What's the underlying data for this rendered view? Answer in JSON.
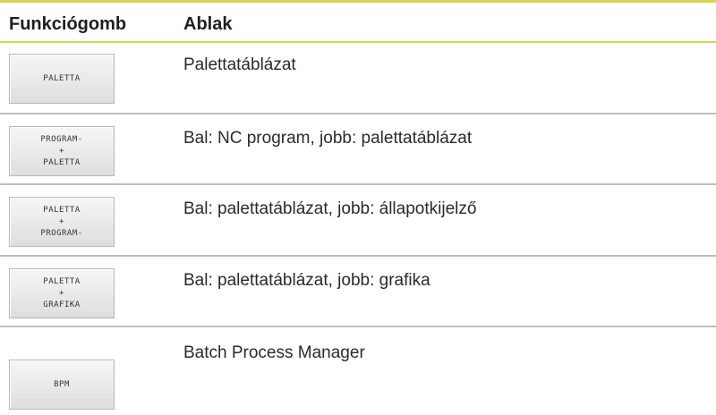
{
  "header": {
    "col1": "Funkciógomb",
    "col2": "Ablak"
  },
  "rows": [
    {
      "softkey_lines": [
        "PALETTA"
      ],
      "description": "Palettatáblázat"
    },
    {
      "softkey_lines": [
        "PROGRAM-",
        "+",
        "PALETTA"
      ],
      "description": "Bal: NC program, jobb: palettatáblázat"
    },
    {
      "softkey_lines": [
        "PALETTA",
        "+",
        "PROGRAM-"
      ],
      "description": "Bal: palettatáblázat, jobb: állapotkijelző"
    },
    {
      "softkey_lines": [
        "PALETTA",
        "+",
        "GRAFIKA"
      ],
      "description": "Bal: palettatáblázat, jobb: grafika"
    },
    {
      "softkey_lines": [
        "BPM"
      ],
      "description": "Batch Process Manager"
    }
  ],
  "colors": {
    "accent_rule": "#d6d64b",
    "row_separator": "#bdbdbd"
  }
}
